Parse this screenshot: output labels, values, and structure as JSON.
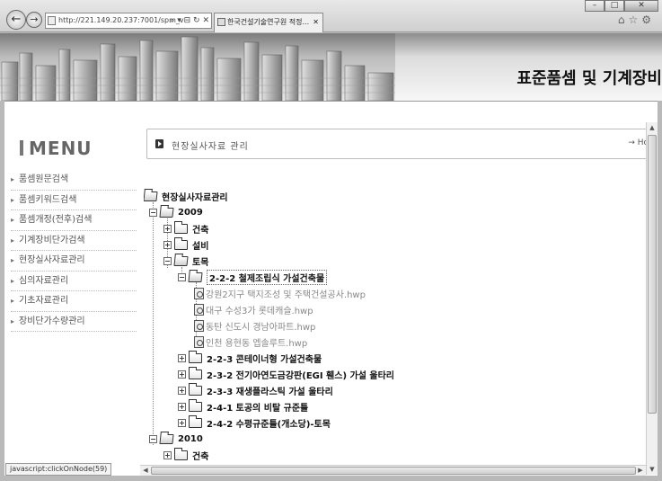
{
  "browser": {
    "address": "http://221.149.20.237:7001/spm_v",
    "tab_title": "한국건설기술연구원 적정...",
    "window_buttons": [
      "minimize",
      "maximize",
      "close"
    ]
  },
  "banner": {
    "title": "표준품셈 및 기계장비"
  },
  "sidebar": {
    "title": "MENU",
    "items": [
      {
        "label": "품셈원문검색"
      },
      {
        "label": "품셈키워드검색"
      },
      {
        "label": "품셈개정(전후)검색"
      },
      {
        "label": "기계장비단가검색"
      },
      {
        "label": "현장실사자료관리"
      },
      {
        "label": "심의자료관리"
      },
      {
        "label": "기초자료관리"
      },
      {
        "label": "장비단가수량관리"
      }
    ]
  },
  "location": {
    "title": "현장실사자료 관리",
    "home": "→ Ho"
  },
  "tree": {
    "root": "현장실사자료관리",
    "y2009": "2009",
    "arch": "건축",
    "equip": "설비",
    "civil": "토목",
    "n222": "2-2-2 철제조립식 가설건축물",
    "files": [
      "강원2지구 택지조성 및 주택건설공사.hwp",
      "대구 수성3가 롯데캐슬.hwp",
      "동탄 신도시 경남아파트.hwp",
      "인천 용현동 엡솔루트.hwp"
    ],
    "n223": "2-2-3 콘테이너형 가설건축물",
    "n232": "2-3-2 전기아연도금강판(EGI 휀스) 가설 울타리",
    "n233": "2-3-3 재생플라스틱 가설 울타리",
    "n241": "2-4-1 토공의 비탈 규준틀",
    "n242": "2-4-2 수평규준틀(개소당)-토목",
    "y2010": "2010",
    "arch2010": "건축"
  },
  "status_bar": "javascript:clickOnNode(59)"
}
